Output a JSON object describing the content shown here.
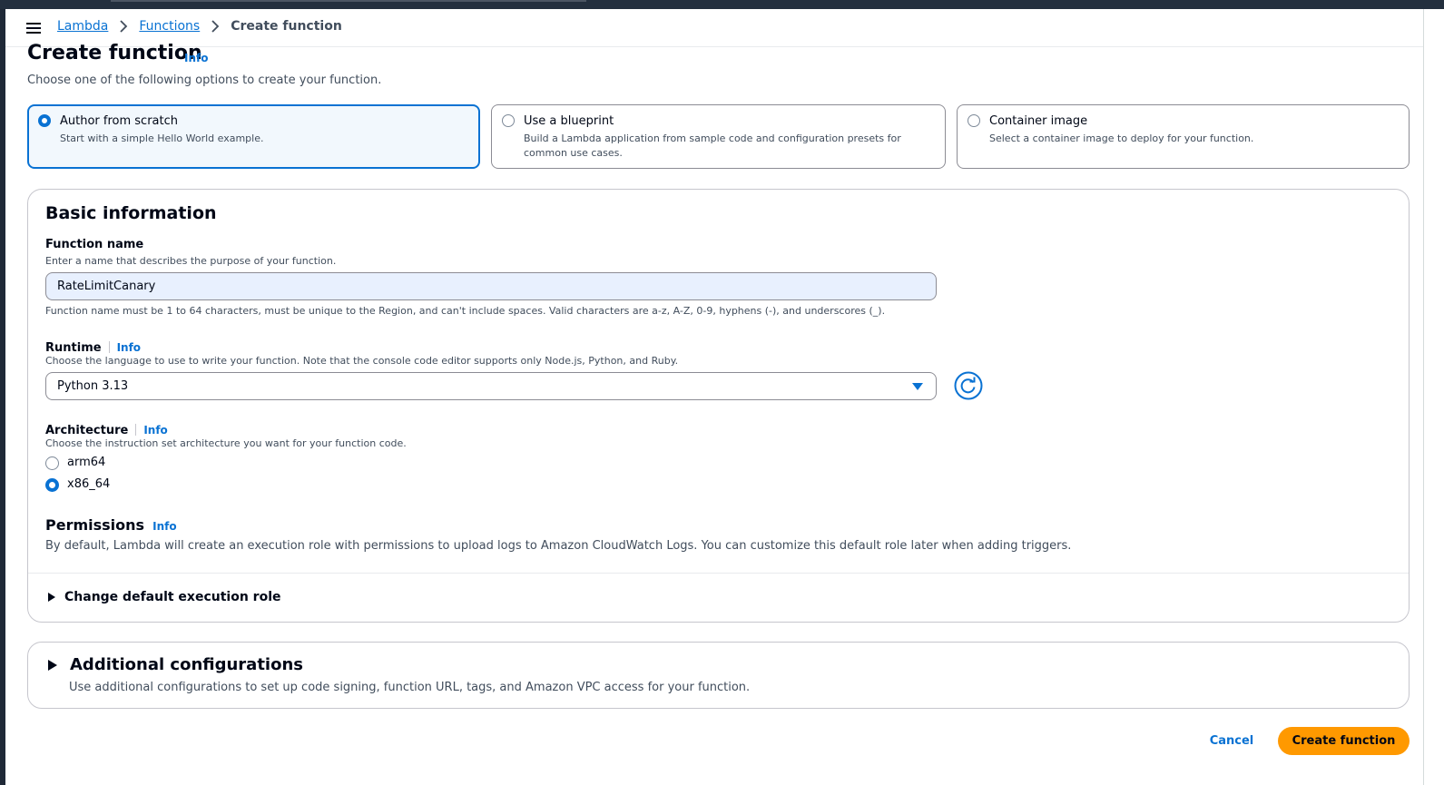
{
  "header": {
    "breadcrumbs": [
      "Lambda",
      "Functions"
    ],
    "current": "Create function"
  },
  "page": {
    "title": "Create function",
    "info": "Info",
    "subtitle": "Choose one of the following options to create your function."
  },
  "options": [
    {
      "title": "Author from scratch",
      "desc": "Start with a simple Hello World example.",
      "selected": true
    },
    {
      "title": "Use a blueprint",
      "desc": "Build a Lambda application from sample code and configuration presets for common use cases.",
      "selected": false
    },
    {
      "title": "Container image",
      "desc": "Select a container image to deploy for your function.",
      "selected": false
    }
  ],
  "basic": {
    "heading": "Basic information",
    "function_name": {
      "label": "Function name",
      "desc": "Enter a name that describes the purpose of your function.",
      "value": "RateLimitCanary",
      "constraint": "Function name must be 1 to 64 characters, must be unique to the Region, and can't include spaces. Valid characters are a-z, A-Z, 0-9, hyphens (-), and underscores (_)."
    },
    "runtime": {
      "label": "Runtime",
      "info": "Info",
      "desc": "Choose the language to use to write your function. Note that the console code editor supports only Node.js, Python, and Ruby.",
      "value": "Python 3.13"
    },
    "architecture": {
      "label": "Architecture",
      "info": "Info",
      "desc": "Choose the instruction set architecture you want for your function code.",
      "options": [
        "arm64",
        "x86_64"
      ],
      "selected": "x86_64"
    },
    "permissions": {
      "heading": "Permissions",
      "info": "Info",
      "desc": "By default, Lambda will create an execution role with permissions to upload logs to Amazon CloudWatch Logs. You can customize this default role later when adding triggers.",
      "expander": "Change default execution role"
    }
  },
  "additional": {
    "heading": "Additional configurations",
    "desc": "Use additional configurations to set up code signing, function URL, tags, and Amazon VPC access for your function."
  },
  "actions": {
    "cancel": "Cancel",
    "create": "Create function"
  },
  "colors": {
    "accent": "#0972d3",
    "primary_button": "#ff9900",
    "topbar": "#232f3e"
  }
}
